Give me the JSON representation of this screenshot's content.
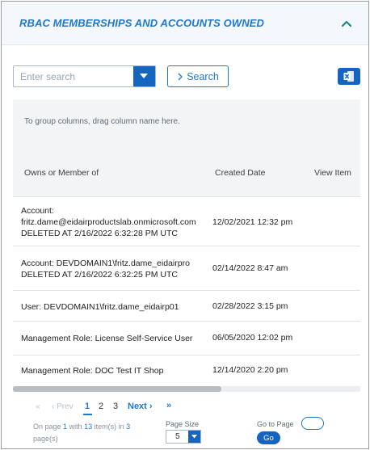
{
  "panel": {
    "title": "RBAC MEMBERSHIPS AND ACCOUNTS OWNED",
    "collapse_icon": "chevron-up-icon",
    "accent_color": "#1f78c8"
  },
  "toolbar": {
    "search_placeholder": "Enter search",
    "search_value": "",
    "search_button_label": "Search",
    "search_button_icon": "chevron-right-icon",
    "dropdown_icon": "caret-down-icon",
    "export_icon": "excel-icon"
  },
  "grid": {
    "group_hint": "To group columns, drag column name here.",
    "columns": [
      "Owns or Member of",
      "Created Date",
      "View Item"
    ],
    "rows": [
      {
        "owner_lines": [
          "Account:",
          "fritz.dame@eidairproductslab.onmicrosoft.com",
          "DELETED AT 2/16/2022 6:32:28 PM UTC"
        ],
        "created": "12/02/2021 12:32 pm"
      },
      {
        "owner_lines": [
          "Account: DEVDOMAIN1\\fritz.dame_eidairpro",
          "DELETED AT 2/16/2022 6:32:25 PM UTC"
        ],
        "created": "02/14/2022 8:47 am"
      },
      {
        "owner_lines": [
          "User: DEVDOMAIN1\\fritz.dame_eidairp01"
        ],
        "created": "02/28/2022 3:15 pm"
      },
      {
        "owner_lines": [
          "Management Role: License Self-Service User"
        ],
        "created": "06/05/2020 12:02 pm"
      },
      {
        "owner_lines": [
          "Management Role: DOC Test IT Shop"
        ],
        "created": "12/14/2020 2:20 pm"
      }
    ]
  },
  "pager": {
    "first_icon": "double-chevron-left-icon",
    "prev_label": "Prev",
    "pages": [
      "1",
      "2",
      "3"
    ],
    "current_page": "1",
    "next_label": "Next",
    "last_icon": "double-chevron-right-icon",
    "info_prefix": "On page",
    "info_page": "1",
    "info_with": "with",
    "info_count": "13",
    "info_items": "item(s) in",
    "info_total": "3",
    "info_pages": "page(s)",
    "page_size_label": "Page Size",
    "page_size_value": "5",
    "goto_label": "Go to Page",
    "goto_value": "",
    "go_label": "Go"
  }
}
